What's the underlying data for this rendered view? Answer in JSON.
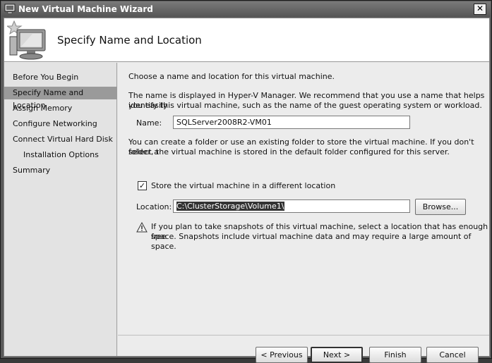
{
  "window": {
    "title": "New Virtual Machine Wizard",
    "close_label": "✕"
  },
  "header": {
    "title": "Specify Name and Location"
  },
  "sidebar": {
    "items": [
      {
        "label": "Before You Begin"
      },
      {
        "label": "Specify Name and Location",
        "active": true
      },
      {
        "label": "Assign Memory"
      },
      {
        "label": "Configure Networking"
      },
      {
        "label": "Connect Virtual Hard Disk"
      },
      {
        "label": "Installation Options",
        "indent": true
      },
      {
        "label": "Summary"
      }
    ]
  },
  "main": {
    "intro": "Choose a name and location for this virtual machine.",
    "name_desc_1": "The name is displayed in Hyper-V Manager. We recommend that you use a name that helps you easily",
    "name_desc_2": "identify this virtual machine, such as the name of the guest operating system or workload.",
    "name_label": "Name:",
    "name_value": "SQLServer2008R2-VM01",
    "folder_desc_1": "You can create a folder or use an existing folder to store the virtual machine. If you don't select a",
    "folder_desc_2": "folder, the virtual machine is stored in the default folder configured for this server.",
    "store_checkbox_label": "Store the virtual machine in a different location",
    "store_checked": true,
    "location_label": "Location:",
    "location_value": "C:\\ClusterStorage\\Volume1\\",
    "browse_label": "Browse...",
    "warning_1": "If you plan to take snapshots of this virtual machine, select a location that has enough free",
    "warning_2": "space. Snapshots include virtual machine data and may require a large amount of space."
  },
  "footer": {
    "previous_label": "< Previous",
    "next_label": "Next >",
    "finish_label": "Finish",
    "cancel_label": "Cancel"
  }
}
